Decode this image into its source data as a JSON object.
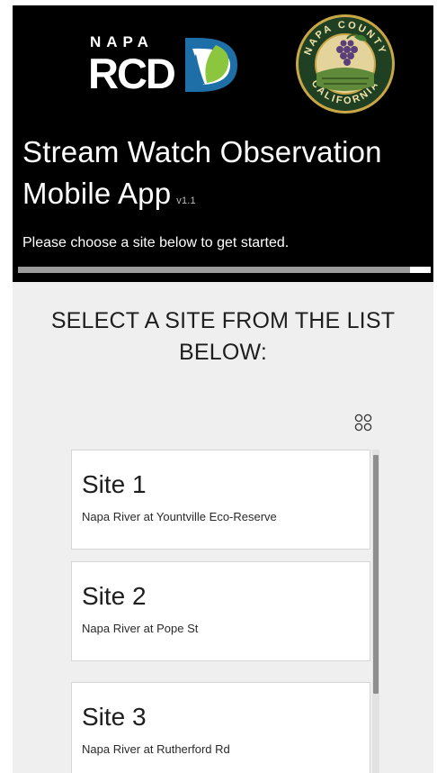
{
  "header": {
    "logo_rcd_text": "RCD",
    "logo_napa_text": "NAPA",
    "seal_top_text": "NAPA COUNTY",
    "seal_bottom_text": "CALIFORNIA",
    "title": "Stream Watch Observation Mobile App",
    "version": "v1.1",
    "subtitle": "Please choose a site below to get started.",
    "progress_fraction": 0.95
  },
  "main": {
    "heading": "SELECT A SITE FROM THE LIST BELOW:",
    "view_toggle_icon": "grid-view-icon",
    "sites": [
      {
        "title": "Site 1",
        "description": "Napa River at Yountville Eco-Reserve"
      },
      {
        "title": "Site 2",
        "description": "Napa River at Pope St"
      },
      {
        "title": "Site 3",
        "description": "Napa River at Rutherford Rd"
      }
    ]
  },
  "colors": {
    "header_bg": "#000000",
    "content_bg": "#efefef",
    "rcd_blue": "#1e6fa8",
    "rcd_green": "#8cc63f"
  }
}
